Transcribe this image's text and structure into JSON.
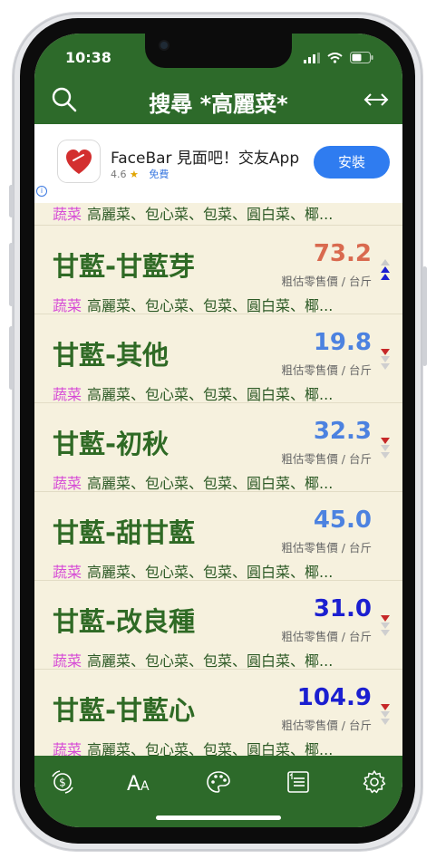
{
  "status": {
    "time": "10:38"
  },
  "header": {
    "title": "搜尋 *高麗菜*"
  },
  "ad": {
    "app_name": "FaceBar 見面吧！交友App",
    "rating": "4.6",
    "rating_star": "★",
    "price": "免費",
    "install_label": "安裝",
    "info_mark": "i"
  },
  "partial_row": {
    "category": "蔬菜",
    "aliases": "高麗菜、包心菜、包菜、圓白菜、椰..."
  },
  "rows": [
    {
      "name": "甘藍-甘藍芽",
      "price": "73.2",
      "price_color": "#d96a4f",
      "unit": "粗估零售價 / 台斤",
      "category": "蔬菜",
      "aliases": "高麗菜、包心菜、包菜、圓白菜、椰...",
      "trend": "up-blue"
    },
    {
      "name": "甘藍-其他",
      "price": "19.8",
      "price_color": "#4c82e0",
      "unit": "粗估零售價 / 台斤",
      "category": "蔬菜",
      "aliases": "高麗菜、包心菜、包菜、圓白菜、椰...",
      "trend": "down-red"
    },
    {
      "name": "甘藍-初秋",
      "price": "32.3",
      "price_color": "#4c82e0",
      "unit": "粗估零售價 / 台斤",
      "category": "蔬菜",
      "aliases": "高麗菜、包心菜、包菜、圓白菜、椰...",
      "trend": "down-red"
    },
    {
      "name": "甘藍-甜甘藍",
      "price": "45.0",
      "price_color": "#4c82e0",
      "unit": "粗估零售價 / 台斤",
      "category": "蔬菜",
      "aliases": "高麗菜、包心菜、包菜、圓白菜、椰...",
      "trend": "none"
    },
    {
      "name": "甘藍-改良種",
      "price": "31.0",
      "price_color": "#1b1fd0",
      "unit": "粗估零售價 / 台斤",
      "category": "蔬菜",
      "aliases": "高麗菜、包心菜、包菜、圓白菜、椰...",
      "trend": "down-red"
    },
    {
      "name": "甘藍-甘藍心",
      "price": "104.9",
      "price_color": "#1b1fd0",
      "unit": "粗估零售價 / 台斤",
      "category": "蔬菜",
      "aliases": "高麗菜、包心菜、包菜、圓白菜、椰...",
      "trend": "down-red"
    }
  ],
  "tabbar": {
    "icons": [
      "currency-exchange-icon",
      "font-size-icon",
      "palette-icon",
      "list-icon",
      "gear-icon"
    ]
  },
  "colors": {
    "brand_green": "#2d6a2a",
    "list_bg": "#f6f1de",
    "category_pink": "#d64ad6",
    "install_blue": "#2f7cf0"
  }
}
